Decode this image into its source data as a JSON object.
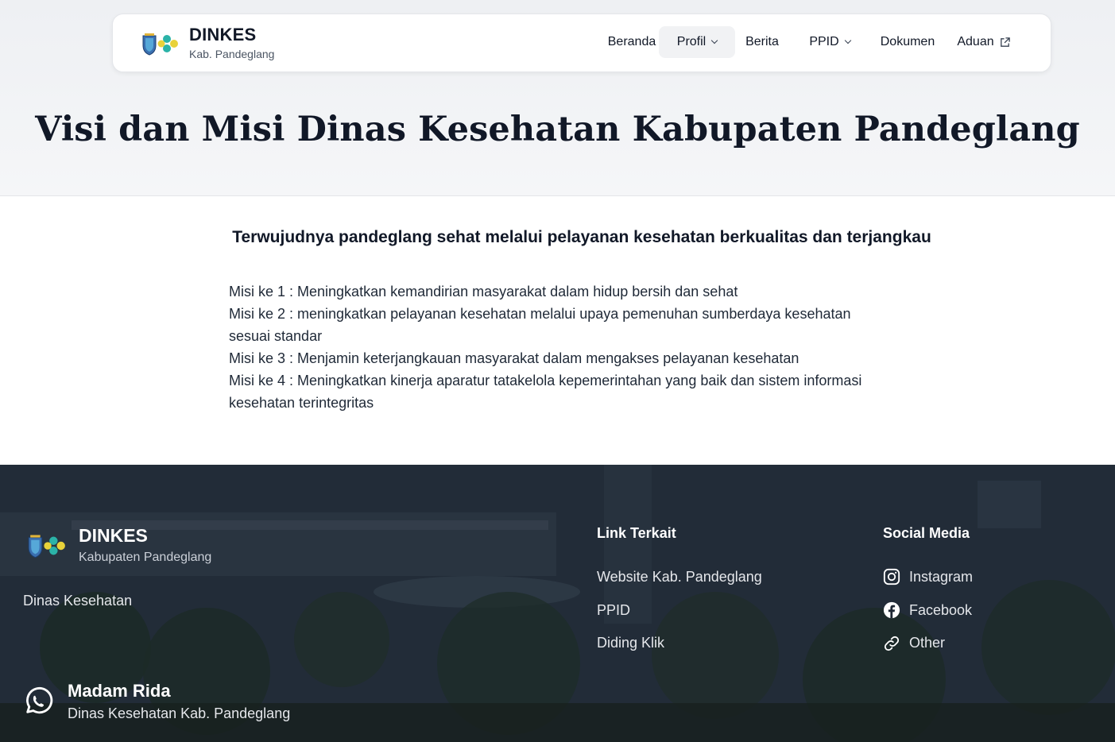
{
  "header": {
    "brand_name": "DINKES",
    "brand_sub": "Kab. Pandeglang",
    "nav": [
      {
        "label": "Beranda"
      },
      {
        "label": "Profil"
      },
      {
        "label": "Berita"
      },
      {
        "label": "PPID"
      },
      {
        "label": "Dokumen"
      },
      {
        "label": "Aduan"
      }
    ],
    "page_title": "Visi dan Misi Dinas Kesehatan Kabupaten Pandeglang"
  },
  "content": {
    "visi": "Terwujudnya pandeglang sehat melalui pelayanan kesehatan berkualitas dan terjangkau",
    "misi_lines": [
      "Misi ke 1 : Meningkatkan kemandirian masyarakat dalam hidup bersih dan sehat",
      "Misi ke 2 : meningkatkan pelayanan kesehatan melalui upaya pemenuhan sumberdaya kesehatan",
      "sesuai standar",
      "Misi ke 3 : Menjamin keterjangkauan masyarakat dalam mengakses pelayanan kesehatan",
      "Misi ke 4 : Meningkatkan kinerja aparatur tatakelola kepemerintahan yang baik dan sistem informasi",
      "kesehatan terintegritas"
    ]
  },
  "footer": {
    "brand_name": "DINKES",
    "brand_sub": "Kabupaten Pandeglang",
    "description": "Dinas Kesehatan",
    "link_title": "Link Terkait",
    "links": [
      "Website Kab. Pandeglang",
      "PPID",
      "Diding Klik"
    ],
    "social_title": "Social Media",
    "social": [
      {
        "label": "Instagram",
        "icon": "instagram-icon"
      },
      {
        "label": "Facebook",
        "icon": "facebook-icon"
      },
      {
        "label": "Other",
        "icon": "link-icon"
      }
    ],
    "contact_name": "Madam Rida",
    "contact_sub": "Dinas Kesehatan Kab. Pandeglang"
  },
  "colors": {
    "footer_bg": "#1e2733",
    "text_dark": "#111827",
    "logo_teal": "#2bb3a8",
    "logo_yellow": "#e8d23a"
  }
}
